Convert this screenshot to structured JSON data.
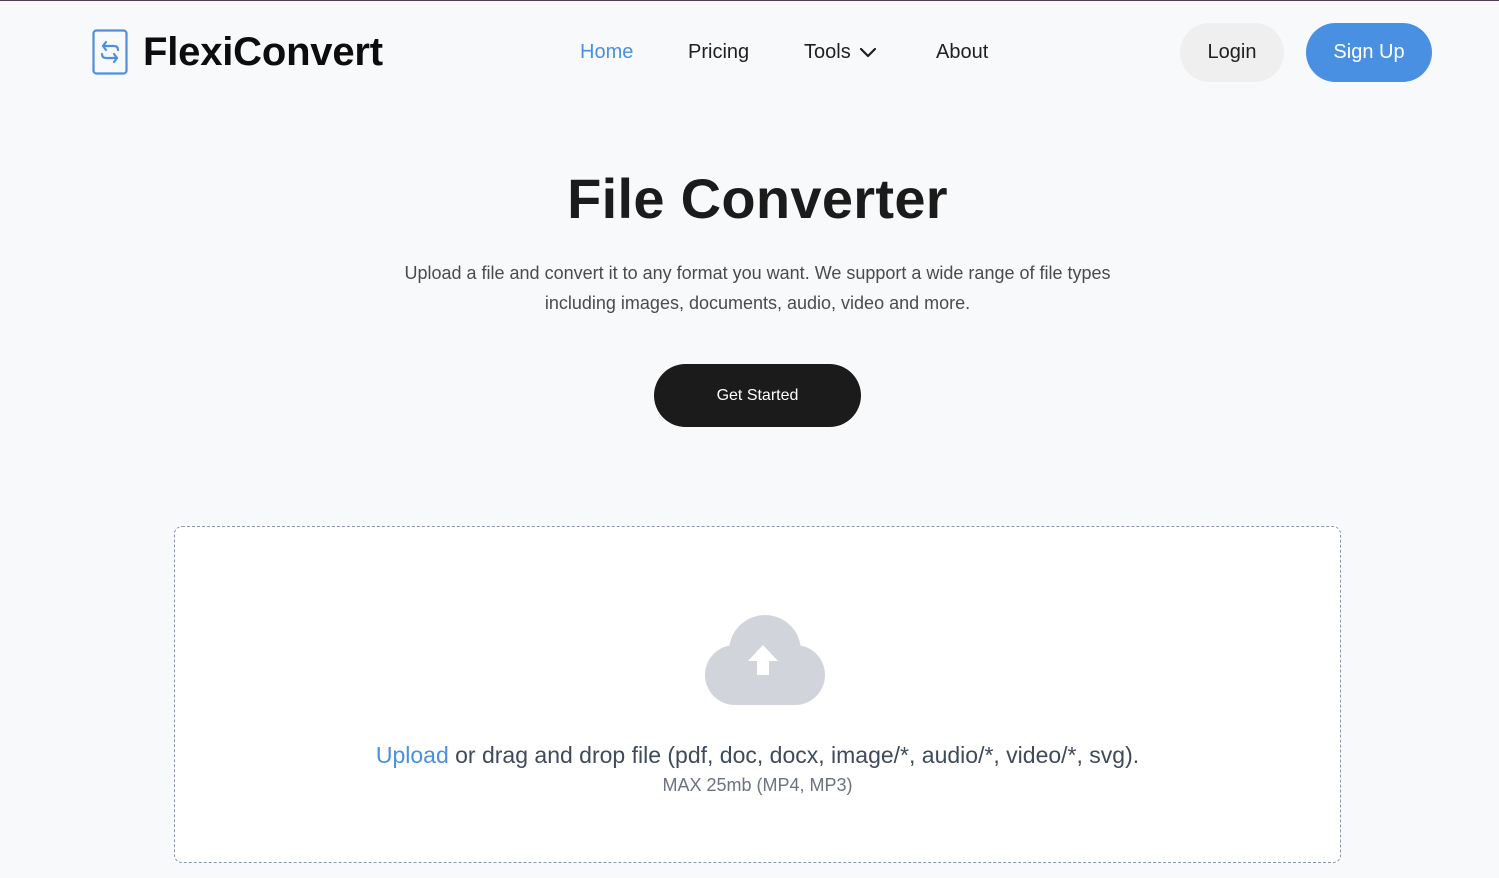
{
  "header": {
    "brand_name": "FlexiConvert",
    "nav": {
      "home": "Home",
      "pricing": "Pricing",
      "tools": "Tools",
      "about": "About"
    },
    "login_label": "Login",
    "signup_label": "Sign Up"
  },
  "hero": {
    "title": "File Converter",
    "description": "Upload a file and convert it to any format you want. We support a wide range of file types including images, documents, audio, video and more.",
    "cta_label": "Get Started"
  },
  "dropzone": {
    "upload_link": "Upload",
    "instruction": " or drag and drop file (pdf, doc, docx, image/*, audio/*, video/*, svg).",
    "limit": "MAX 25mb (MP4, MP3)"
  },
  "icons": {
    "logo": "file-convert-icon",
    "tools_dropdown": "chevron-down-icon",
    "upload": "cloud-upload-icon"
  },
  "colors": {
    "accent": "#4a90e2",
    "dark": "#1b1b1b",
    "background": "#f8f9fb",
    "cloud": "#d1d5db"
  }
}
